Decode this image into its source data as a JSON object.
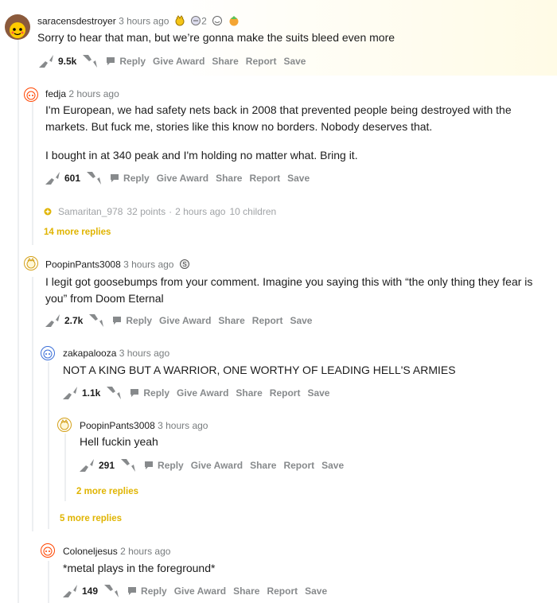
{
  "comments": [
    {
      "user": "saracensdestroyer",
      "time": "3 hours ago",
      "award_count": "2",
      "body": "Sorry to hear that man, but we’re gonna make the suits bleed even more",
      "score": "9.5k"
    },
    {
      "user": "fedja",
      "time": "2 hours ago",
      "body": "I'm European, we had safety nets back in 2008 that prevented people being destroyed with the markets. But fuck me, stories like this know no borders. Nobody deserves that.",
      "body2": "I bought in at 340 peak and I'm holding no matter what. Bring it.",
      "score": "601"
    },
    {
      "user": "PoopinPants3008",
      "time": "3 hours ago",
      "body": "I legit got goosebumps from your comment. Imagine you saying this with “the only thing they fear is you” from Doom Eternal",
      "score": "2.7k"
    },
    {
      "user": "zakapalooza",
      "time": "3 hours ago",
      "body": "NOT A KING BUT A WARRIOR, ONE WORTHY OF LEADING HELL'S ARMIES",
      "score": "1.1k"
    },
    {
      "user": "PoopinPants3008",
      "time": "3 hours ago",
      "body": "Hell fuckin yeah",
      "score": "291"
    },
    {
      "user": "Coloneljesus",
      "time": "2 hours ago",
      "body": "*metal plays in the foreground*",
      "score": "149"
    }
  ],
  "collapsed": {
    "user": "Samaritan_978",
    "points": "32 points",
    "sep": "·",
    "time": "2 hours ago",
    "children": "10 children"
  },
  "more_replies": {
    "a": "14 more replies",
    "b": "2 more replies",
    "c": "5 more replies"
  },
  "actions": {
    "reply": "Reply",
    "give_award": "Give Award",
    "share": "Share",
    "report": "Report",
    "save": "Save"
  },
  "colors": {
    "accent": "#e0b400",
    "muted": "#878a8c",
    "text": "#1c1c1c"
  },
  "icons": [
    "upvote-icon",
    "downvote-icon",
    "comment-bubble-icon",
    "avatar-icon",
    "award-icon"
  ]
}
